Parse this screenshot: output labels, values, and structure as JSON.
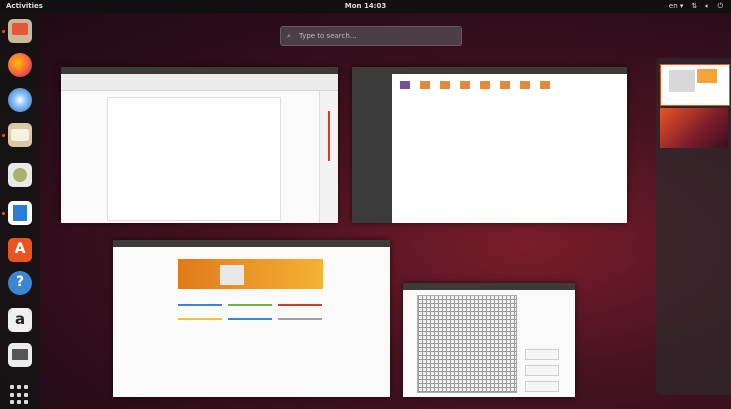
{
  "topbar": {
    "activities": "Activities",
    "clock": "Mon 14:03",
    "status_menu": "en ▾",
    "colors": {
      "bar": "#101010",
      "text": "#dddddd"
    }
  },
  "search": {
    "placeholder": "Type to search…",
    "icon": "search-icon"
  },
  "dock": {
    "apps": [
      {
        "name": "files",
        "color": "#c9b998",
        "active": true
      },
      {
        "name": "firefox",
        "color": "#e66000",
        "active": false
      },
      {
        "name": "thunderbird",
        "color": "#2a6fb6",
        "active": false
      },
      {
        "name": "rhythmbox",
        "color": "#d9c9a6",
        "active": true
      },
      {
        "name": "libreoffice-draw",
        "color": "#a8b26a",
        "active": false
      },
      {
        "name": "libreoffice-writer",
        "color": "#2a7fd4",
        "active": true
      },
      {
        "name": "ubuntu-software",
        "color": "#e95420",
        "active": false
      },
      {
        "name": "help",
        "color": "#3a86d4",
        "active": false
      },
      {
        "name": "amazon",
        "color": "#f0f0f0",
        "active": false
      },
      {
        "name": "terminal",
        "color": "#ececec",
        "active": false
      }
    ],
    "show_apps_icon": "grid-icon"
  },
  "windows": [
    {
      "name": "writer-document",
      "app": "LibreOffice Writer"
    },
    {
      "name": "file-manager",
      "app": "Files"
    },
    {
      "name": "libreoffice-start-center",
      "app": "LibreOffice"
    },
    {
      "name": "image-dialog",
      "app": "Dialog"
    }
  ],
  "colors": {
    "accent": "#e95420",
    "titlebar": "#3c3b37",
    "sidebar": "#3b3b3b"
  }
}
